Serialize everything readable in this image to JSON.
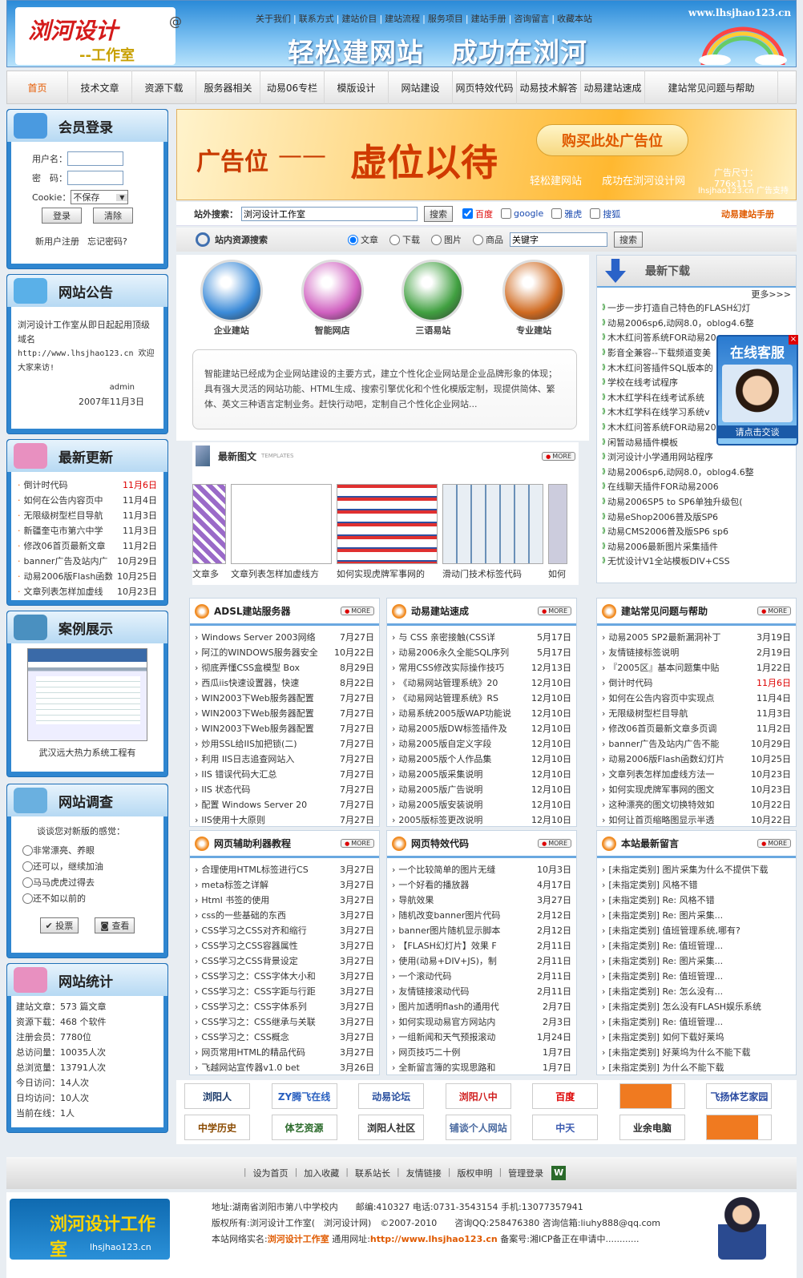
{
  "header": {
    "logo_title": "浏河设计",
    "logo_sub": "--工作室",
    "logo_at": "@",
    "site_url": "www.lhsjhao123.cn",
    "slogan": "轻松建网站　成功在浏河",
    "top_links": [
      "关于我们",
      "联系方式",
      "建站价目",
      "建站流程",
      "服务项目",
      "建站手册",
      "咨询留言",
      "收藏本站"
    ]
  },
  "nav": [
    "首页",
    "技术文章",
    "资源下载",
    "服务器相关",
    "动易06专栏",
    "模版设计",
    "网站建设",
    "网页特效代码",
    "动易技术解答",
    "动易建站速成",
    "建站常见问题与帮助"
  ],
  "login": {
    "title": "会员登录",
    "username_label": "用户名：",
    "password_label": "密　码：",
    "cookie_label": "Cookie：",
    "cookie_value": "不保存",
    "login_btn": "登录",
    "clear_btn": "清除",
    "register": "新用户注册",
    "forgot": "忘记密码?"
  },
  "notice": {
    "title": "网站公告",
    "text1": "浏河设计工作室从即日起起用顶级域名",
    "text2": "http://www.lhsjhao123.cn 欢迎大家来访!",
    "author": "admin",
    "date": "2007年11月3日"
  },
  "latest": {
    "title": "最新更新",
    "items": [
      {
        "t": "倒计时代码",
        "d": "11月6日",
        "hot": true
      },
      {
        "t": "如何在公告内容页中",
        "d": "11月4日"
      },
      {
        "t": "无限级树型栏目导航",
        "d": "11月3日"
      },
      {
        "t": "新疆奎屯市第六中学",
        "d": "11月3日"
      },
      {
        "t": "修改06首页最新文章",
        "d": "11月2日"
      },
      {
        "t": "banner广告及站内广",
        "d": "10月29日"
      },
      {
        "t": "动易2006版Flash函数",
        "d": "10月25日"
      },
      {
        "t": "文章列表怎样加虚线",
        "d": "10月23日"
      }
    ]
  },
  "cases": {
    "title": "案例展示",
    "caption": "武汉远大热力系统工程有"
  },
  "survey": {
    "title": "网站调查",
    "question": "谈谈您对新版的感觉：",
    "options": [
      "非常漂亮、养眼",
      "还可以，继续加油",
      "马马虎虎过得去",
      "还不如以前的"
    ],
    "vote": "投票",
    "view": "查看"
  },
  "stats": {
    "title": "网站统计",
    "lines": [
      "建站文章：573 篇文章",
      "资源下载：468 个软件",
      "注册会员：7780位",
      "总访问量：10035人次",
      "总浏览量：13791人次",
      "今日访问：14人次",
      "日均访问：10人次",
      "当前在线：1人"
    ]
  },
  "banner": {
    "left": "广告位",
    "dash": "——",
    "big": "虚位以待",
    "buy": "购买此处广告位",
    "small1": "轻松建网站",
    "small2": "成功在浏河设计网",
    "size": "广告尺寸：776x115",
    "support": "lhsjhao123.cn 广告支持"
  },
  "search_ext": {
    "label": "站外搜索：",
    "value": "浏河设计工作室",
    "btn": "搜索",
    "engines": [
      "百度",
      "google",
      "雅虎",
      "搜狐"
    ],
    "manual": "动易建站手册"
  },
  "search_int": {
    "label": "站内资源搜索",
    "options": [
      "文章",
      "下载",
      "图片",
      "商品"
    ],
    "value": "关键字",
    "btn": "搜索"
  },
  "services": {
    "icons": [
      "企业建站",
      "智能网店",
      "三语易站",
      "专业建站"
    ],
    "desc": "智能建站已经成为企业网站建设的主要方式，建立个性化企业网站是企业品牌形象的体现；具有强大灵活的网站功能、HTML生成、搜索引擎优化和个性化模版定制，现提供简体、繁体、英文三种语言定制业务。赶快行动吧，定制自己个性化企业网站..."
  },
  "downloads": {
    "title": "最新下载",
    "more": "更多>>>",
    "items": [
      "一步一步打造自己特色的FLASH幻灯",
      "动易2006sp6,动网8.0，oblog4.6整",
      "木木红问答系统FOR动易20",
      "影音全兼容--下载频道变美",
      "木木红问答插件SQL版本的",
      "学校在线考试程序",
      "木木红学科在线考试系统",
      "木木红学科在线学习系统v",
      "木木红问答系统FOR动易20",
      "闲暂动易插件模板",
      "浏河设计小学通用网站程序",
      "动易2006sp6,动网8.0，oblog4.6整",
      "在线聊天插件FOR动易2006",
      "动易2006SP5 to SP6单独升级包(",
      "动易eShop2006普及版SP6",
      "动易CMS2006普及版SP6 sp6",
      "动易2006最新图片采集插件",
      "无忧设计V1全站模板DIV+CSS"
    ]
  },
  "service_float": {
    "title": "在线客服",
    "btn": "请点击交谈"
  },
  "pics": {
    "title": "最新图文",
    "sub": "TEMPLATES",
    "more": "MORE",
    "captions": [
      "文章多",
      "文章列表怎样加虚线方",
      "如何实现虎牌军事网的",
      "滑动门技术标签代码",
      "如何"
    ]
  },
  "adsl": {
    "title": "ADSL建站服务器",
    "more": "MORE",
    "items": [
      [
        "Windows Server 2003网络",
        "7月27日"
      ],
      [
        "阿江的WINDOWS服务器安全",
        "10月22日"
      ],
      [
        "彻底弄懂CSS盒模型 Box",
        "8月29日"
      ],
      [
        "西瓜iis快速设置器，快速",
        "8月22日"
      ],
      [
        "WIN2003下Web服务器配置",
        "7月27日"
      ],
      [
        "WIN2003下Web服务器配置",
        "7月27日"
      ],
      [
        "WIN2003下Web服务器配置",
        "7月27日"
      ],
      [
        "炒用SSL给IIS加把锁(二)",
        "7月27日"
      ],
      [
        "利用 IIS日志追查网站入",
        "7月27日"
      ],
      [
        "IIS 错误代码大汇总",
        "7月27日"
      ],
      [
        "IIS 状态代码",
        "7月27日"
      ],
      [
        "配置 Windows Server 20",
        "7月27日"
      ],
      [
        "IIS使用十大原则",
        "7月27日"
      ]
    ]
  },
  "quick": {
    "title": "动易建站速成",
    "more": "MORE",
    "items": [
      [
        "与 CSS 亲密接触(CSS详",
        "5月17日"
      ],
      [
        "动易2006永久全能SQL序列",
        "5月17日"
      ],
      [
        "常用CSS修改实际操作技巧",
        "12月13日"
      ],
      [
        "《动易网站管理系统》20",
        "12月10日"
      ],
      [
        "《动易网站管理系统》RS",
        "12月10日"
      ],
      [
        "动易系统2005版WAP功能说",
        "12月10日"
      ],
      [
        "动易2005版DW标签插件及",
        "12月10日"
      ],
      [
        "动易2005版自定义字段",
        "12月10日"
      ],
      [
        "动易2005版个人作品集",
        "12月10日"
      ],
      [
        "动易2005版采集说明",
        "12月10日"
      ],
      [
        "动易2005版广告说明",
        "12月10日"
      ],
      [
        "动易2005版安装说明",
        "12月10日"
      ],
      [
        "2005版标签更改说明",
        "12月10日"
      ]
    ]
  },
  "faq": {
    "title": "建站常见问题与帮助",
    "more": "MORE",
    "items": [
      [
        "动易2005 SP2最新漏洞补丁",
        "3月19日"
      ],
      [
        "友情链接标签说明",
        "2月19日"
      ],
      [
        "『2005区』基本问题集中贴",
        "1月22日"
      ],
      [
        "倒计时代码",
        "11月6日"
      ],
      [
        "如何在公告内容页中实现点",
        "11月4日"
      ],
      [
        "无限级树型栏目导航",
        "11月3日"
      ],
      [
        "修改06首页最新文章多页调",
        "11月2日"
      ],
      [
        "banner广告及站内广告不能",
        "10月29日"
      ],
      [
        "动易2006版Flash函数幻灯片",
        "10月25日"
      ],
      [
        "文章列表怎样加虚线方法一",
        "10月23日"
      ],
      [
        "如何实现虎牌军事网的图文",
        "10月23日"
      ],
      [
        "这种漂亮的图文切换特效如",
        "10月22日"
      ],
      [
        "如何让首页缩略图显示半透",
        "10月22日"
      ]
    ]
  },
  "tools": {
    "title": "网页辅助利器教程",
    "more": "MORE",
    "items": [
      [
        "合理使用HTML标签进行CS",
        "3月27日"
      ],
      [
        "meta标签之详解",
        "3月27日"
      ],
      [
        "Html 书签的使用",
        "3月27日"
      ],
      [
        "css的一些基础的东西",
        "3月27日"
      ],
      [
        "CSS学习之CSS对齐和缩行",
        "3月27日"
      ],
      [
        "CSS学习之CSS容器属性",
        "3月27日"
      ],
      [
        "CSS学习之CSS背景设定",
        "3月27日"
      ],
      [
        "CSS学习之：CSS字体大小和",
        "3月27日"
      ],
      [
        "CSS学习之：CSS字距与行距",
        "3月27日"
      ],
      [
        "CSS学习之：CSS字体系列",
        "3月27日"
      ],
      [
        "CSS学习之：CSS继承与关联",
        "3月27日"
      ],
      [
        "CSS学习之：CSS概念",
        "3月27日"
      ],
      [
        "网页常用HTML的精品代码",
        "3月27日"
      ],
      [
        "飞越网站宣传器v1.0 bet",
        "3月26日"
      ]
    ]
  },
  "effects": {
    "title": "网页特效代码",
    "more": "MORE",
    "items": [
      [
        "一个比较简单的图片无缝",
        "10月3日"
      ],
      [
        "一个好看的播放器",
        "4月17日"
      ],
      [
        "导航效果",
        "3月27日"
      ],
      [
        "随机改变banner图片代码",
        "2月12日"
      ],
      [
        "banner图片随机显示脚本",
        "2月12日"
      ],
      [
        "【FLASH幻灯片】效果 F",
        "2月11日"
      ],
      [
        "使用(动易+DIV+JS)，制",
        "2月11日"
      ],
      [
        "一个滚动代码",
        "2月11日"
      ],
      [
        "友情链接滚动代码",
        "2月11日"
      ],
      [
        "图片加透明flash的通用代",
        "2月7日"
      ],
      [
        "如何实现动易官方网站内",
        "2月3日"
      ],
      [
        "一组新闻和天气预报滚动",
        "1月24日"
      ],
      [
        "网页技巧二十例",
        "1月7日"
      ],
      [
        "全新留言簿的实现思路和",
        "1月7日"
      ]
    ]
  },
  "guestbook": {
    "title": "本站最新留言",
    "more": "MORE",
    "items": [
      "[未指定类别] 图片采集为什么不提供下载",
      "[未指定类别] 风格不错",
      "[未指定类别] Re: 风格不错",
      "[未指定类别] Re: 图片采集...",
      "[未指定类别] 值班管理系统,哪有?",
      "[未指定类别] Re: 值班管理...",
      "[未指定类别] Re: 图片采集...",
      "[未指定类别] Re: 值班管理...",
      "[未指定类别] Re: 怎么没有...",
      "[未指定类别] 怎么没有FLASH娱乐系统",
      "[未指定类别] Re: 值班管理...",
      "[未指定类别] 如何下载好莱坞",
      "[未指定类别] 好莱坞为什么不能下载",
      "[未指定类别] 为什么不能下载"
    ]
  },
  "friend_logos": [
    "浏阳人",
    "ZY腾飞在线",
    "动易论坛",
    "浏阳八中",
    "百度",
    "",
    "飞扬体艺家园",
    "中学历史",
    "体艺资源",
    "浏阳人社区",
    "铺谈个人网站",
    "中天",
    "业余电脑",
    ""
  ],
  "footer": {
    "links": [
      "设为首页",
      "加入收藏",
      "联系站长",
      "友情链接",
      "版权申明",
      "管理登录"
    ],
    "brand": "浏河设计工作室",
    "brand_url": "lhsjhao123.cn",
    "line1": "地址:湖南省浏阳市第八中学校内　　邮编:410327 电话:0731-3543154 手机:13077357941",
    "line2": "版权所有:浏河设计工作室(　浏河设计网)　©2007-2010　　咨询QQ:258476380 咨询信箱:liuhy888@qq.com",
    "line3a": "本站网络实名:",
    "line3b": "浏河设计工作室",
    "line3c": " 通用网址:",
    "line3d": "http://www.lhsjhao123.cn",
    "line3e": " 备案号:湘ICP备正在申请中............"
  }
}
